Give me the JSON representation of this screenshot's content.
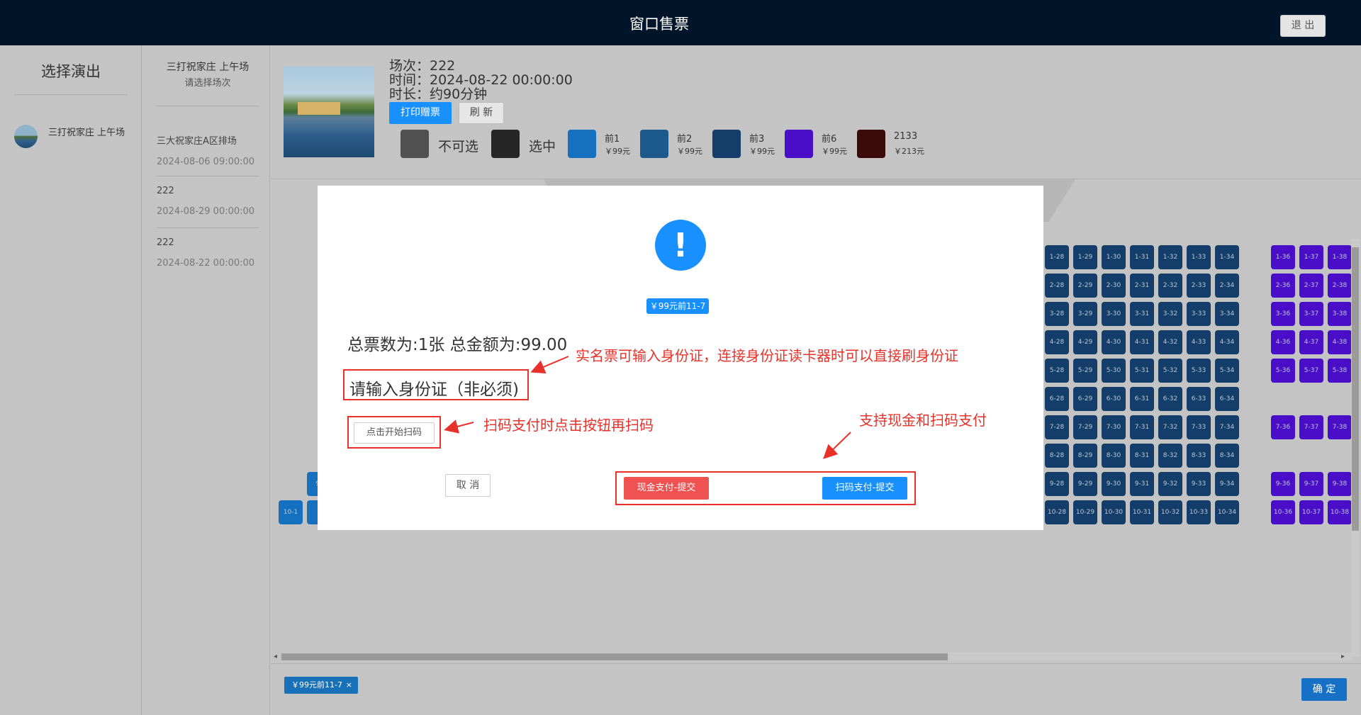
{
  "header": {
    "title": "窗口售票",
    "logout_label": "退 出"
  },
  "sidebar": {
    "heading": "选择演出",
    "performances": [
      {
        "name": "三打祝家庄 上午场"
      }
    ]
  },
  "sessions_panel": {
    "show_title": "三打祝家庄 上午场",
    "hint": "请选择场次",
    "sessions": [
      {
        "name": "三大祝家庄A区排场",
        "datetime": "2024-08-06 09:00:00"
      },
      {
        "name": "222",
        "datetime": "2024-08-29 00:00:00"
      },
      {
        "name": "222",
        "datetime": "2024-08-22 00:00:00"
      }
    ]
  },
  "show_info": {
    "session": "场次：222",
    "time": "时间：2024-08-22 00:00:00",
    "duration": "时长：约90分钟",
    "print_label": "打印赠票",
    "refresh_label": "刷 新"
  },
  "legend": [
    {
      "label": "不可选",
      "color": "#505050"
    },
    {
      "label": "选中",
      "color": "#262626"
    },
    {
      "name": "前1",
      "price": "￥99元",
      "color": "#1570c0"
    },
    {
      "name": "前2",
      "price": "￥99元",
      "color": "#1c5a8e"
    },
    {
      "name": "前3",
      "price": "￥99元",
      "color": "#143e69"
    },
    {
      "name": "前6",
      "price": "￥99元",
      "color": "#4a0ec9"
    },
    {
      "name": "2133",
      "price": "￥213元",
      "color": "#3d0a0a"
    }
  ],
  "seats": {
    "right_block_cols": [
      "28",
      "29",
      "30",
      "31",
      "32",
      "33",
      "34"
    ],
    "purple_cols": [
      "36",
      "37",
      "38"
    ],
    "rows": [
      "1",
      "2",
      "3",
      "4",
      "5",
      "6",
      "7",
      "8",
      "9",
      "10"
    ],
    "purple_rows": [
      "1",
      "2",
      "3",
      "4",
      "5",
      "7",
      "9",
      "10"
    ],
    "left_visible": [
      "9-",
      "10-1",
      "1"
    ]
  },
  "bottom": {
    "selected_chip": "￥99元前11-7",
    "chip_close": "×",
    "confirm_label": "确 定"
  },
  "modal": {
    "icon": "!",
    "tag": "￥99元前11-7",
    "total": "总票数为:1张 总金额为:99.00",
    "id_placeholder": "请输入身份证（非必须)",
    "scan_label": "点击开始扫码",
    "cancel_label": "取 消",
    "cash_label": "现金支付-提交",
    "qr_label": "扫码支付-提交"
  },
  "annotations": {
    "id_note": "实名票可输入身份证，连接身份证读卡器时可以直接刷身份证",
    "scan_note": "扫码支付时点击按钮再扫码",
    "pay_note": "支持现金和扫码支付"
  }
}
